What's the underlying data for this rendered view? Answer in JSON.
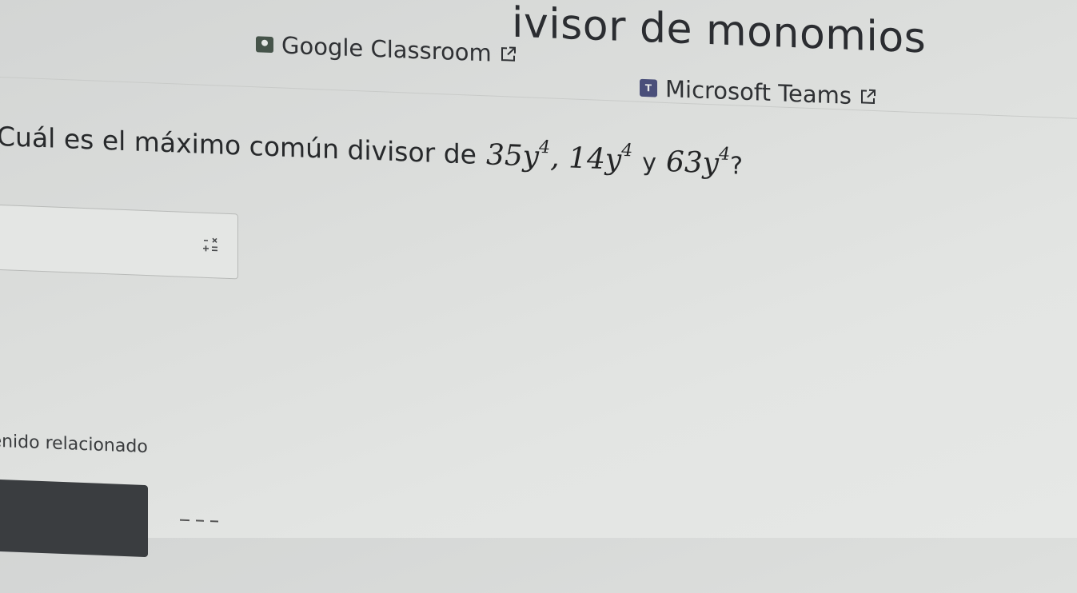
{
  "header": {
    "title": "ivisor de monomios"
  },
  "share": {
    "classroom_label": "Google Classroom",
    "teams_label": "Microsoft Teams",
    "teams_icon_glyph": "T"
  },
  "question": {
    "prompt": "Cuál es el máximo común divisor de",
    "term1": {
      "base": "35y",
      "exp": "4"
    },
    "sep": ",",
    "term2": {
      "base": "14y",
      "exp": "4"
    },
    "connector": "y",
    "term3": {
      "base": "63y",
      "exp": "4"
    },
    "end": "?"
  },
  "answer": {
    "value": ""
  },
  "related": {
    "label": "ntenido relacionado"
  },
  "icons": {
    "classroom": "google-classroom-icon",
    "teams": "microsoft-teams-icon",
    "external": "external-link-icon",
    "keypad": "math-keypad-icon"
  },
  "colors": {
    "background": "#dcdedc",
    "text": "#2a2b2c",
    "dark_card": "#3a3d40"
  }
}
